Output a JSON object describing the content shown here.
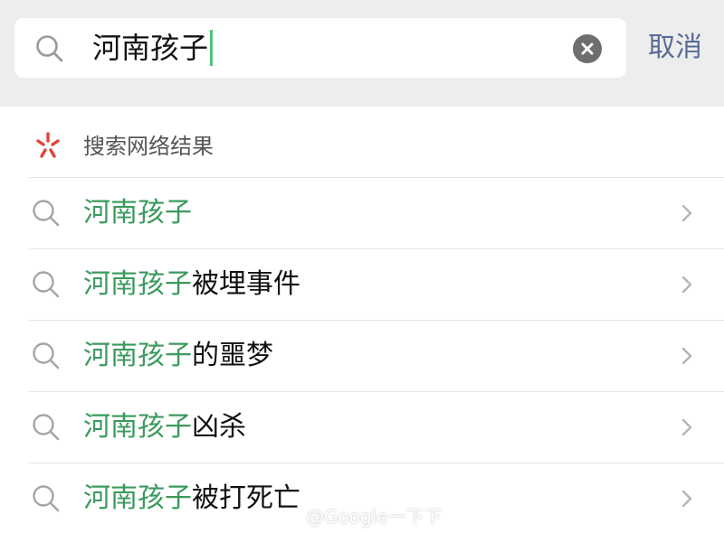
{
  "search": {
    "query": "河南孩子",
    "cancel_label": "取消"
  },
  "results": {
    "section_label": "搜索网络结果",
    "items": [
      {
        "highlight": "河南孩子",
        "rest": ""
      },
      {
        "highlight": "河南孩子",
        "rest": "被埋事件"
      },
      {
        "highlight": "河南孩子",
        "rest": "的噩梦"
      },
      {
        "highlight": "河南孩子",
        "rest": "凶杀"
      },
      {
        "highlight": "河南孩子",
        "rest": "被打死亡"
      }
    ]
  },
  "watermark": {
    "text": "@Google一下下"
  },
  "colors": {
    "accent_green": "#3a9a5c",
    "cancel_blue": "#576b95",
    "caret_green": "#4ec47a",
    "star_red": "#e0443a"
  },
  "icons": [
    "search-icon",
    "clear-icon",
    "sparkle-icon",
    "chevron-right-icon",
    "weibo-icon"
  ]
}
